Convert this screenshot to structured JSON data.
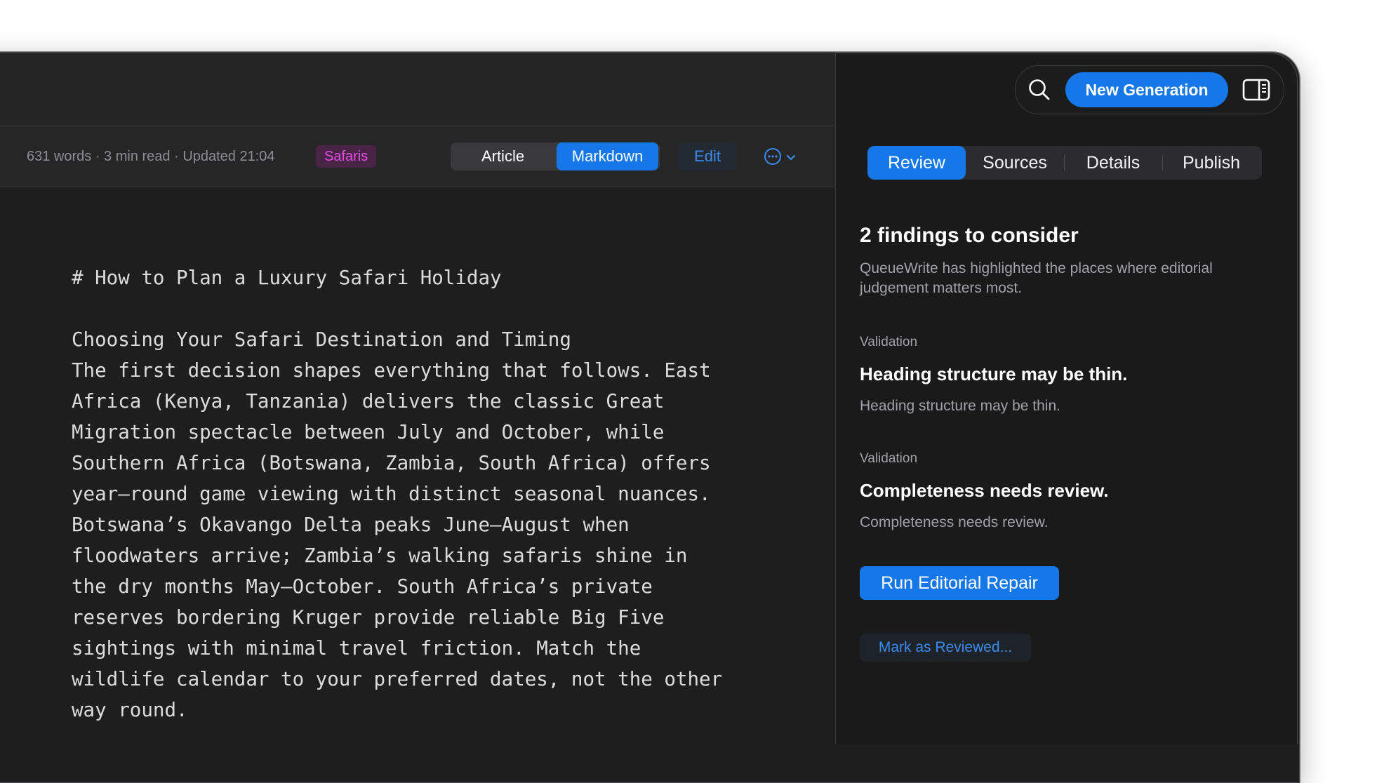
{
  "toolbar": {
    "meta": "631 words · 3 min read · Updated 21:04",
    "tag": "Safaris",
    "view_modes": [
      "Article",
      "Markdown"
    ],
    "active_view": "Markdown",
    "edit_label": "Edit",
    "more_icon": "ellipsis-circle-icon"
  },
  "editor": {
    "lines": [
      "# How to Plan a Luxury Safari Holiday",
      "",
      "Choosing Your Safari Destination and Timing",
      "The first decision shapes everything that follows. East",
      "Africa (Kenya, Tanzania) delivers the classic Great",
      "Migration spectacle between July and October, while",
      "Southern Africa (Botswana, Zambia, South Africa) offers",
      "year–round game viewing with distinct seasonal nuances.",
      "Botswana’s Okavango Delta peaks June–August when",
      "floodwaters arrive; Zambia’s walking safaris shine in",
      "the dry months May–October. South Africa’s private",
      "reserves bordering Kruger provide reliable Big Five",
      "sightings with minimal travel friction. Match the",
      "wildlife calendar to your preferred dates, not the other",
      "way round."
    ]
  },
  "header": {
    "new_generation_label": "New Generation",
    "search_icon": "search-icon",
    "sidebar_icon": "sidebar-toggle-icon"
  },
  "inspector": {
    "tabs": [
      "Review",
      "Sources",
      "Details",
      "Publish"
    ],
    "active_tab": "Review",
    "title": "2 findings to consider",
    "description": "QueueWrite has highlighted the places where editorial judgement matters most.",
    "findings": [
      {
        "label": "Validation",
        "title": "Heading structure may be thin.",
        "body": "Heading structure may be thin."
      },
      {
        "label": "Validation",
        "title": "Completeness needs review.",
        "body": "Completeness needs review."
      }
    ],
    "repair_label": "Run Editorial Repair",
    "mark_label": "Mark as Reviewed..."
  },
  "colors": {
    "accent": "#1677e8",
    "tag_text": "#e14fe0",
    "tag_bg": "#4a2447",
    "background": "#1e1e1f"
  }
}
